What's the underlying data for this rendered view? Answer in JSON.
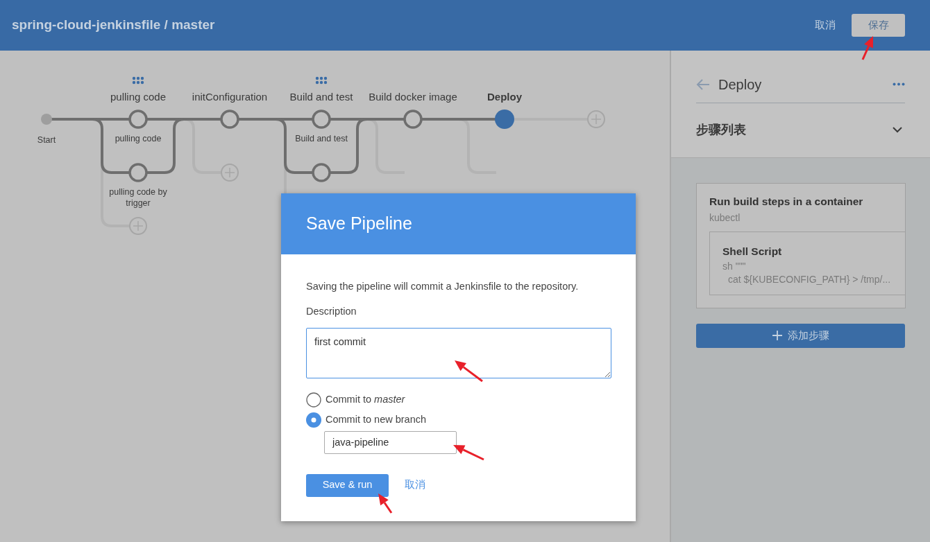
{
  "header": {
    "title": "spring-cloud-jenkinsfile / master",
    "cancel": "取消",
    "save": "保存"
  },
  "pipeline": {
    "start": "Start",
    "stages": [
      {
        "name": "pulling code",
        "selected": false,
        "branches": [
          {
            "kind": "labeled",
            "label": "pulling code"
          },
          {
            "kind": "labeled",
            "label": "pulling code by trigger"
          }
        ]
      },
      {
        "name": "initConfiguration",
        "selected": false
      },
      {
        "name": "Build and test",
        "selected": false,
        "branches": [
          {
            "kind": "labeled",
            "label": "Build and test"
          },
          {
            "kind": "unlabeled"
          }
        ]
      },
      {
        "name": "Build docker image",
        "selected": false
      },
      {
        "name": "Deploy",
        "selected": true
      }
    ]
  },
  "sidebar": {
    "title": "Deploy",
    "section": "步骤列表",
    "expanded": true,
    "steps": [
      {
        "title": "Run build steps in a container",
        "detail": "kubectl",
        "children": [
          {
            "title": "Shell Script",
            "lines": [
              "sh \"\"\"",
              "cat ${KUBECONFIG_PATH} > /tmp/..."
            ]
          }
        ]
      }
    ],
    "add_step": "添加步骤"
  },
  "dialog": {
    "title": "Save Pipeline",
    "message": "Saving the pipeline will commit a Jenkinsfile to the repository.",
    "description_label": "Description",
    "description": "first commit",
    "options": [
      {
        "label": "Commit to *master*",
        "selected": false
      },
      {
        "label": "Commit to new branch",
        "selected": true,
        "value": "java-pipeline"
      }
    ],
    "primary": "Save & run",
    "cancel": "取消"
  }
}
